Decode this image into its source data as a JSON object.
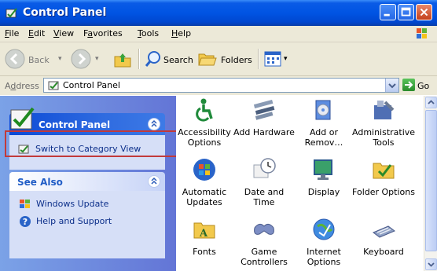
{
  "window": {
    "title": "Control Panel"
  },
  "menu": [
    {
      "label": "File",
      "key": "F",
      "rest": "ile"
    },
    {
      "label": "Edit",
      "key": "E",
      "rest": "dit"
    },
    {
      "label": "View",
      "key": "V",
      "rest": "iew"
    },
    {
      "label": "Favorites",
      "key": "a",
      "pre": "F",
      "rest": "vorites"
    },
    {
      "label": "Tools",
      "key": "T",
      "rest": "ools"
    },
    {
      "label": "Help",
      "key": "H",
      "rest": "elp"
    }
  ],
  "toolbar": {
    "back_label": "Back",
    "search_label": "Search",
    "folders_label": "Folders"
  },
  "address": {
    "label_key": "d",
    "label_pre": "A",
    "label_rest": "dress",
    "value": "Control Panel",
    "go_label": "Go"
  },
  "left": {
    "cp_box": {
      "title": "Control Panel",
      "switch_link": "Switch to Category View"
    },
    "see_also": {
      "title": "See Also",
      "links": [
        "Windows Update",
        "Help and Support"
      ]
    }
  },
  "items": [
    {
      "label": "Accessibility Options",
      "icon": "accessibility-icon"
    },
    {
      "label": "Add Hardware",
      "icon": "add-hardware-icon"
    },
    {
      "label": "Add or Remov…",
      "icon": "add-remove-programs-icon"
    },
    {
      "label": "Administrative Tools",
      "icon": "administrative-tools-icon"
    },
    {
      "label": "Automatic Updates",
      "icon": "automatic-updates-icon"
    },
    {
      "label": "Date and Time",
      "icon": "date-time-icon"
    },
    {
      "label": "Display",
      "icon": "display-icon"
    },
    {
      "label": "Folder Options",
      "icon": "folder-options-icon"
    },
    {
      "label": "Fonts",
      "icon": "fonts-icon"
    },
    {
      "label": "Game Controllers",
      "icon": "game-controllers-icon"
    },
    {
      "label": "Internet Options",
      "icon": "internet-options-icon"
    },
    {
      "label": "Keyboard",
      "icon": "keyboard-icon"
    }
  ],
  "colors": {
    "title_blue": "#0054e3",
    "task_pane": "#6375d6",
    "highlight_box": "#c23a3a"
  }
}
